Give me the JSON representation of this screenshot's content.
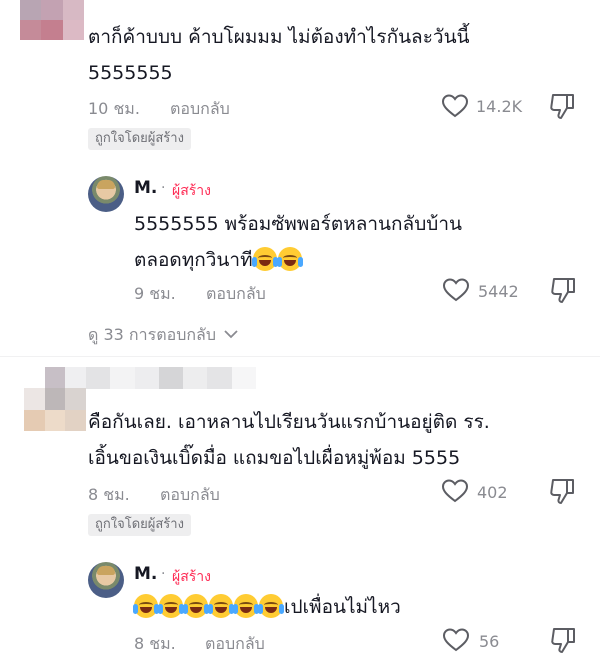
{
  "comments": [
    {
      "text": "ตาก็ค้าบบบ ค้าบโผมมม ไม่ต้องทำไรกันละวันนี้ 5555555",
      "line1": "ตาก็ค้าบบบ ค้าบโผมมม ไม่ต้องทำไรกันละวันนี้",
      "line2": "5555555",
      "time": "10 ชม.",
      "reply_label": "ตอบกลับ",
      "likes": "14.2K",
      "liked_by_creator": "ถูกใจโดยผู้สร้าง",
      "reply": {
        "author": "M.",
        "creator_tag": "ผู้สร้าง",
        "separator": "·",
        "line1": "5555555 พร้อมซัพพอร์ตหลานกลับบ้าน",
        "line2": "ตลอดทุกวินาที",
        "time": "9 ชม.",
        "reply_label": "ตอบกลับ",
        "likes": "5442"
      },
      "view_replies": "ดู 33 การตอบกลับ"
    },
    {
      "line1": "คือกันเลย. เอาหลานไปเรียนวันแรกบ้านอยู่ติด รร.",
      "line2": "เอิ้นขอเงินเบิ๊ดมื่อ แถมขอไปเผื่อหมู่พ้อม 5555",
      "time": "8 ชม.",
      "reply_label": "ตอบกลับ",
      "likes": "402",
      "liked_by_creator": "ถูกใจโดยผู้สร้าง",
      "reply": {
        "author": "M.",
        "creator_tag": "ผู้สร้าง",
        "separator": "·",
        "text": "เปเพื่อนไม่ไหว",
        "time": "8 ชม.",
        "reply_label": "ตอบกลับ",
        "likes": "56"
      }
    }
  ],
  "icons": {
    "like": "heart-outline-icon",
    "dislike": "thumbs-down-icon",
    "expand": "chevron-down-icon",
    "emoji": "face-with-tears-of-joy-emoji"
  },
  "colors": {
    "text": "#161823",
    "muted": "#8a8b91",
    "creator": "#fe2c55",
    "badge_bg": "#eeeeef"
  }
}
